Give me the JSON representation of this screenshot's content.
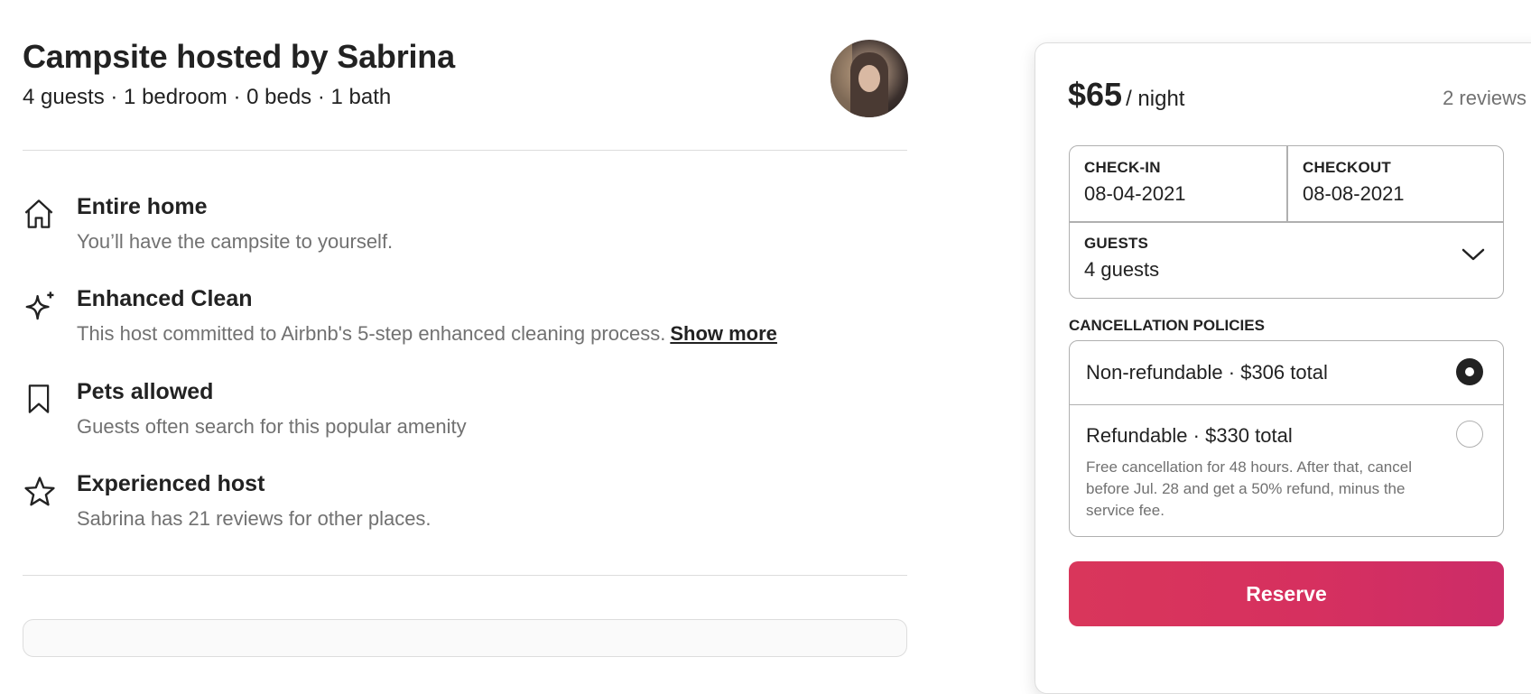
{
  "listing": {
    "title": "Campsite hosted by Sabrina",
    "summary": "4 guests · 1 bedroom · 0 beds · 1 bath"
  },
  "features": [
    {
      "icon": "house-icon",
      "title": "Entire home",
      "description": "You’ll have the campsite to yourself."
    },
    {
      "icon": "sparkle-icon",
      "title": "Enhanced Clean",
      "description": "This host committed to Airbnb's 5-step enhanced cleaning process.",
      "link": "Show more"
    },
    {
      "icon": "bookmark-icon",
      "title": "Pets allowed",
      "description": "Guests often search for this popular amenity"
    },
    {
      "icon": "star-icon",
      "title": "Experienced host",
      "description": "Sabrina has 21 reviews for other places."
    }
  ],
  "booking": {
    "price": "$65",
    "per": "/ night",
    "reviews": "2 reviews",
    "checkin_label": "CHECK-IN",
    "checkin_value": "08-04-2021",
    "checkout_label": "CHECKOUT",
    "checkout_value": "08-08-2021",
    "guests_label": "GUESTS",
    "guests_value": "4 guests",
    "cancellation_label": "CANCELLATION POLICIES",
    "policies": [
      {
        "title": "Non-refundable · $306 total",
        "selected": true
      },
      {
        "title": "Refundable · $330 total",
        "description": "Free cancellation for 48 hours. After that, cancel before Jul. 28 and get a 50% refund, minus the service fee.",
        "selected": false
      }
    ],
    "reserve_label": "Reserve"
  },
  "colors": {
    "accent": "#d9365b",
    "text": "#222222",
    "muted": "#717171",
    "border": "#b0b0b0"
  }
}
